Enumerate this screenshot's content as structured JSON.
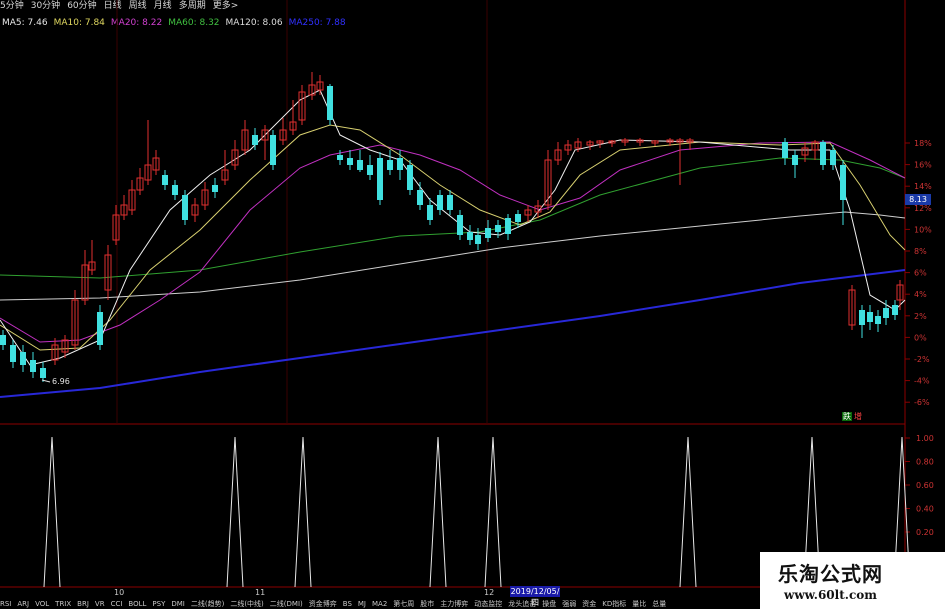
{
  "toolbar": {
    "items": [
      "5分钟",
      "30分钟",
      "60分钟",
      "日线",
      "周线",
      "月线",
      "多周期",
      "更多>"
    ]
  },
  "ma_legend": {
    "ma5": {
      "label": "MA5: 7.46",
      "color": "#e6e6e6"
    },
    "ma10": {
      "label": "MA10: 7.84",
      "color": "#e0d860"
    },
    "ma20": {
      "label": "MA20: 8.22",
      "color": "#d040d0"
    },
    "ma60": {
      "label": "MA60: 8.32",
      "color": "#40c040"
    },
    "ma120": {
      "label": "MA120: 8.06",
      "color": "#dddddd"
    },
    "ma250": {
      "label": "MA250: 7.88",
      "color": "#3030ff"
    }
  },
  "price_low_label": "6.96",
  "price_tag": "8.13",
  "cross_tag": {
    "a": "跌",
    "b": "增"
  },
  "right_axis_main": [
    "18%",
    "16%",
    "14%",
    "12%",
    "10%",
    "8%",
    "6%",
    "4%",
    "2%",
    "0%",
    "-2%",
    "-4%",
    "-6%"
  ],
  "right_axis_sub": [
    "1.00",
    "0.80",
    "0.60",
    "0.40",
    "0.20"
  ],
  "x_labels": [
    "10",
    "11",
    "12"
  ],
  "date_box": "2019/12/05/四",
  "bottom_tabs": [
    "RSI",
    "ARJ",
    "VOL",
    "TRIX",
    "BRJ",
    "VR",
    "CCI",
    "BOLL",
    "PSY",
    "DMI",
    "二线(趋势)",
    "二线(中线)",
    "二线(DMI)",
    "资金博弈",
    "BS",
    "MJ",
    "MA2",
    "第七周",
    "股市",
    "主力博弈",
    "动态监控",
    "龙头追击",
    "操盘",
    "强弱",
    "资金",
    "KD指标",
    "量比",
    "总量"
  ],
  "watermark": {
    "title": "乐淘公式网",
    "url": "www.60lt.com"
  },
  "colors": {
    "up": "#e03030",
    "down": "#40e0e0",
    "grid": "#8b0000",
    "ma250": "#2828d8",
    "signal": "#e8e8e8"
  }
}
